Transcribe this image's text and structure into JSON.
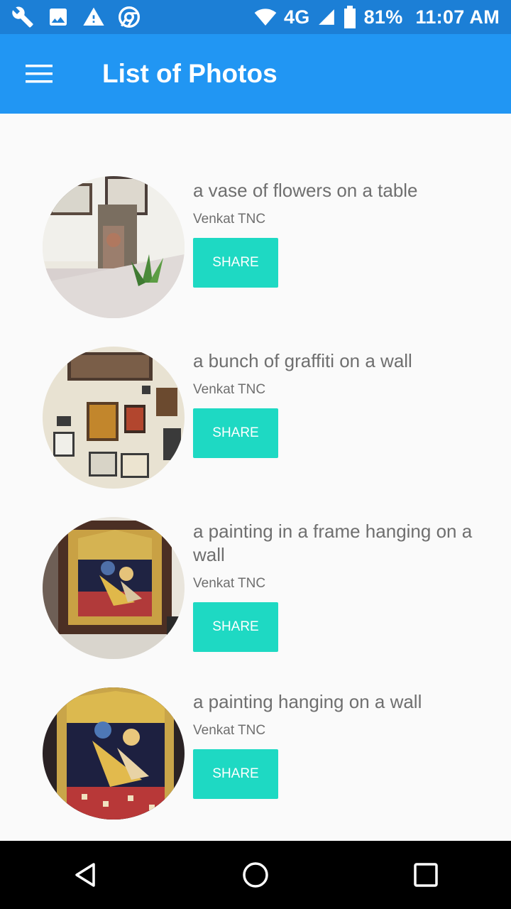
{
  "status_bar": {
    "icons_left": [
      "wrench-icon",
      "image-icon",
      "warning-icon",
      "chrome-icon"
    ],
    "network": "4G",
    "battery": "81%",
    "time": "11:07 AM"
  },
  "app_bar": {
    "title": "List of Photos",
    "menu_icon": "hamburger-menu-icon"
  },
  "photos": [
    {
      "title": "a vase of flowers on a table",
      "author": "Venkat TNC",
      "share_label": "SHARE"
    },
    {
      "title": "a bunch of graffiti on a wall",
      "author": "Venkat TNC",
      "share_label": "SHARE"
    },
    {
      "title": "a painting in a frame hanging on a wall",
      "author": "Venkat TNC",
      "share_label": "SHARE"
    },
    {
      "title": "a painting hanging on a wall",
      "author": "Venkat TNC",
      "share_label": "SHARE"
    }
  ],
  "nav_bar": {
    "buttons": [
      "back-icon",
      "home-icon",
      "recents-icon"
    ]
  },
  "colors": {
    "status_bar": "#1c7fd6",
    "app_bar": "#2196f3",
    "share_button": "#1ed9c3",
    "text": "#6f6f6f",
    "background": "#fafafa"
  }
}
